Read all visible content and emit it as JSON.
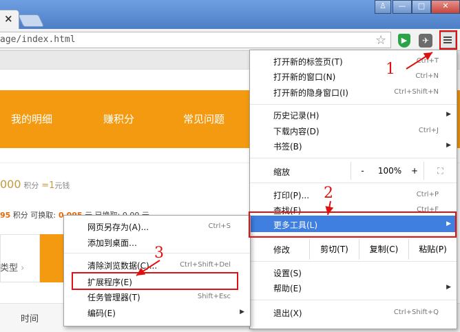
{
  "browser": {
    "tab_close": "×",
    "url": "age/index.html",
    "window_controls": {
      "user": "♙",
      "minimize": "—",
      "maximize": "□",
      "close": "✕"
    }
  },
  "page": {
    "nav": [
      "我的明细",
      "赚积分",
      "常见问题"
    ],
    "points_value": "000",
    "points_unit": "积分",
    "points_eq": "=1",
    "points_yuan": "元钱",
    "row2": {
      "prefix": "95",
      "text1": " 积分 可换取:",
      "text2": " 0.095",
      "text3": " 元 已换取: 0.00 元"
    },
    "type_label": "类型",
    "time_label": "时间"
  },
  "main_menu": {
    "items": [
      {
        "label": "打开新的标签页(T)",
        "shortcut": "Ctrl+T"
      },
      {
        "label": "打开新的窗口(N)",
        "shortcut": "Ctrl+N"
      },
      {
        "label": "打开新的隐身窗口(I)",
        "shortcut": "Ctrl+Shift+N"
      },
      {
        "label": "历史记录(H)",
        "shortcut": ""
      },
      {
        "label": "下载内容(D)",
        "shortcut": "Ctrl+J"
      },
      {
        "label": "书签(B)",
        "shortcut": ""
      },
      {
        "label": "缩放",
        "shortcut": ""
      },
      {
        "label": "打印(P)...",
        "shortcut": "Ctrl+P"
      },
      {
        "label": "查找(F)",
        "shortcut": "Ctrl+F"
      },
      {
        "label": "更多工具(L)",
        "shortcut": ""
      },
      {
        "label": "修改",
        "shortcut": ""
      },
      {
        "label": "设置(S)",
        "shortcut": ""
      },
      {
        "label": "帮助(E)",
        "shortcut": ""
      },
      {
        "label": "退出(X)",
        "shortcut": "Ctrl+Shift+Q"
      }
    ],
    "zoom": {
      "minus": "-",
      "value": "100%",
      "plus": "+",
      "fullscreen": "⛶"
    },
    "edit": {
      "cut": "剪切(T)",
      "copy": "复制(C)",
      "paste": "粘贴(P)"
    }
  },
  "submenu": {
    "items": [
      {
        "label": "网页另存为(A)...",
        "shortcut": "Ctrl+S"
      },
      {
        "label": "添加到桌面…",
        "shortcut": ""
      },
      {
        "label": "清除浏览数据(C)...",
        "shortcut": "Ctrl+Shift+Del"
      },
      {
        "label": "扩展程序(E)",
        "shortcut": ""
      },
      {
        "label": "任务管理器(T)",
        "shortcut": "Shift+Esc"
      },
      {
        "label": "编码(E)",
        "shortcut": ""
      }
    ]
  },
  "annotations": {
    "step1": "1",
    "step2": "2",
    "step3": "3"
  },
  "colors": {
    "accent_orange": "#f39a10",
    "highlight_blue": "#3f7fe0",
    "annotation_red": "#e01010"
  }
}
